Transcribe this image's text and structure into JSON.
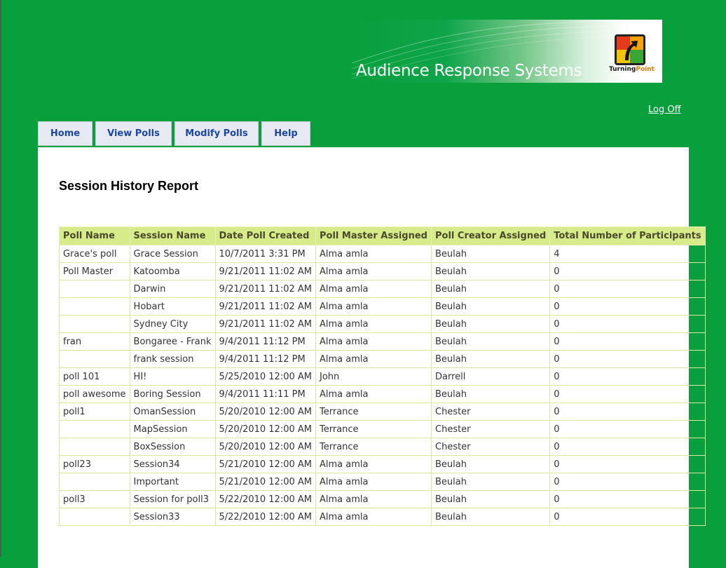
{
  "banner": {
    "title": "Audience Response Systems",
    "logo_text_main": "Turning",
    "logo_text_accent": "Point"
  },
  "header": {
    "logoff_label": "Log Off"
  },
  "nav": {
    "tabs": [
      {
        "label": "Home"
      },
      {
        "label": "View Polls"
      },
      {
        "label": "Modify Polls"
      },
      {
        "label": "Help"
      }
    ]
  },
  "report": {
    "title": "Session History Report",
    "columns": [
      "Poll Name",
      "Session Name",
      "Date Poll Created",
      "Poll Master Assigned",
      "Poll Creator Assigned",
      "Total Number of Participants"
    ],
    "rows": [
      [
        "Grace's poll",
        "Grace Session",
        "10/7/2011 3:31 PM",
        "Alma amla",
        "Beulah",
        "4"
      ],
      [
        "Poll Master",
        "Katoomba",
        "9/21/2011 11:02 AM",
        "Alma amla",
        "Beulah",
        "0"
      ],
      [
        "",
        "Darwin",
        "9/21/2011 11:02 AM",
        "Alma amla",
        "Beulah",
        "0"
      ],
      [
        "",
        "Hobart",
        "9/21/2011 11:02 AM",
        "Alma amla",
        "Beulah",
        "0"
      ],
      [
        "",
        "Sydney City",
        "9/21/2011 11:02 AM",
        "Alma amla",
        "Beulah",
        "0"
      ],
      [
        "fran",
        "Bongaree - Frank",
        "9/4/2011 11:12 PM",
        "Alma amla",
        "Beulah",
        "0"
      ],
      [
        "",
        "frank session",
        "9/4/2011 11:12 PM",
        "Alma amla",
        "Beulah",
        "0"
      ],
      [
        "poll 101",
        "HI!",
        "5/25/2010 12:00 AM",
        "John",
        "Darrell",
        "0"
      ],
      [
        "poll awesome",
        "Boring Session",
        "9/4/2011 11:11 PM",
        "Alma amla",
        "Beulah",
        "0"
      ],
      [
        "poll1",
        "OmanSession",
        "5/20/2010 12:00 AM",
        "Terrance",
        "Chester",
        "0"
      ],
      [
        "",
        "MapSession",
        "5/20/2010 12:00 AM",
        "Terrance",
        "Chester",
        "0"
      ],
      [
        "",
        "BoxSession",
        "5/20/2010 12:00 AM",
        "Terrance",
        "Chester",
        "0"
      ],
      [
        "poll23",
        "Session34",
        "5/21/2010 12:00 AM",
        "Alma amla",
        "Beulah",
        "0"
      ],
      [
        "",
        "Important",
        "5/21/2010 12:00 AM",
        "Alma amla",
        "Beulah",
        "0"
      ],
      [
        "poll3",
        "Session for poll3",
        "5/22/2010 12:00 AM",
        "Alma amla",
        "Beulah",
        "0"
      ],
      [
        "",
        "Session33",
        "5/22/2010 12:00 AM",
        "Alma amla",
        "Beulah",
        "0"
      ]
    ]
  },
  "colors": {
    "page_background": "#07a03c",
    "tab_text": "#1a46a4",
    "table_header_bg": "#d7eb8a",
    "table_border": "#dbe79e"
  }
}
